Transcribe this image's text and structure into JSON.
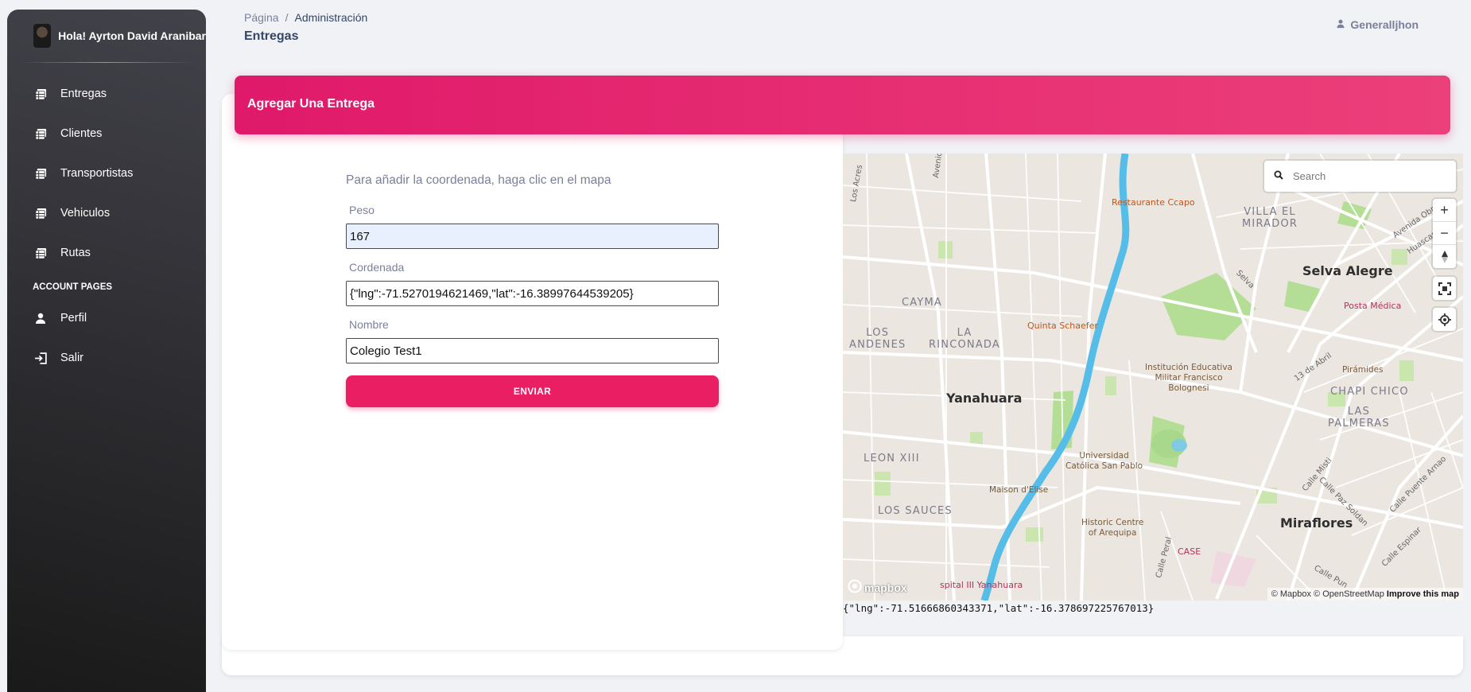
{
  "sidebar": {
    "greeting": "Hola! Ayrton David Aranibar",
    "items": [
      {
        "label": "Entregas",
        "icon": "table-icon"
      },
      {
        "label": "Clientes",
        "icon": "table-icon"
      },
      {
        "label": "Transportistas",
        "icon": "table-icon"
      },
      {
        "label": "Vehiculos",
        "icon": "table-icon"
      },
      {
        "label": "Rutas",
        "icon": "table-icon"
      }
    ],
    "section": "ACCOUNT PAGES",
    "account": [
      {
        "label": "Perfil",
        "icon": "person-icon"
      },
      {
        "label": "Salir",
        "icon": "login-icon"
      }
    ]
  },
  "header": {
    "breadcrumb": {
      "root": "Página",
      "sep": "/",
      "current": "Administración"
    },
    "title": "Entregas",
    "user": "Generalljhon"
  },
  "card": {
    "title": "Agregar Una Entrega"
  },
  "form": {
    "hint": "Para añadir la coordenada, haga clic en el mapa",
    "peso": {
      "label": "Peso",
      "value": "167"
    },
    "cordenada": {
      "label": "Cordenada",
      "value": "{\"lng\":-71.5270194621469,\"lat\":-16.38997644539205}"
    },
    "nombre": {
      "label": "Nombre",
      "value": "Colegio Test1"
    },
    "submit": "ENVIAR"
  },
  "map": {
    "search_placeholder": "Search",
    "labels": {
      "restaurante": "Restaurante Ccapo",
      "villa": "VILLA EL\nMIRADOR",
      "selva_alegre": "Selva Alegre",
      "posta": "Posta Médica",
      "cayma": "CAYMA",
      "los_andenes": "LOS\nANDENES",
      "la_rinconada": "LA\nRINCONADA",
      "quinta": "Quinta Schaefer",
      "institucion": "Institución Educativa\nMilitar Francisco\nBolognesi",
      "piramides": "Pirámides",
      "chapi": "CHAPI CHICO",
      "las_palmeras": "LAS\nPALMERAS",
      "yanahuara": "Yanahuara",
      "leon": "LEON XIII",
      "universidad": "Universidad\nCatólica San Pablo",
      "maison": "Maison d'Elise",
      "los_sauces": "LOS SAUCES",
      "historic": "Historic Centre\nof Arequipa",
      "case": "CASE",
      "miraflores": "Miraflores",
      "hospital": "spital III Yanahuara",
      "avenida_b": "Avenida B",
      "los_acres": "Los Acres",
      "selva": "Selva",
      "abril": "13 de Abril",
      "av_obrera": "Avenida Obrera",
      "huascar": "Huascar",
      "calle_misti": "Calle Misti",
      "calle_paz": "Calle Paz Soldan",
      "calle_puente": "Calle Puente Arnao",
      "calle_espinar": "Calle Espinar",
      "calle_peral": "Calle Peral",
      "calle_pun": "Calle Pun"
    },
    "logo": "mapbox",
    "attribution": "© Mapbox © OpenStreetMap",
    "improve": "Improve this map",
    "clicked_coords": "{\"lng\":-71.51666860343371,\"lat\":-16.378697225767013}"
  },
  "colors": {
    "accent": "#e91e63",
    "sidebar_dark": "#191919",
    "river": "#5bc0eb",
    "park": "#a8d88a"
  }
}
